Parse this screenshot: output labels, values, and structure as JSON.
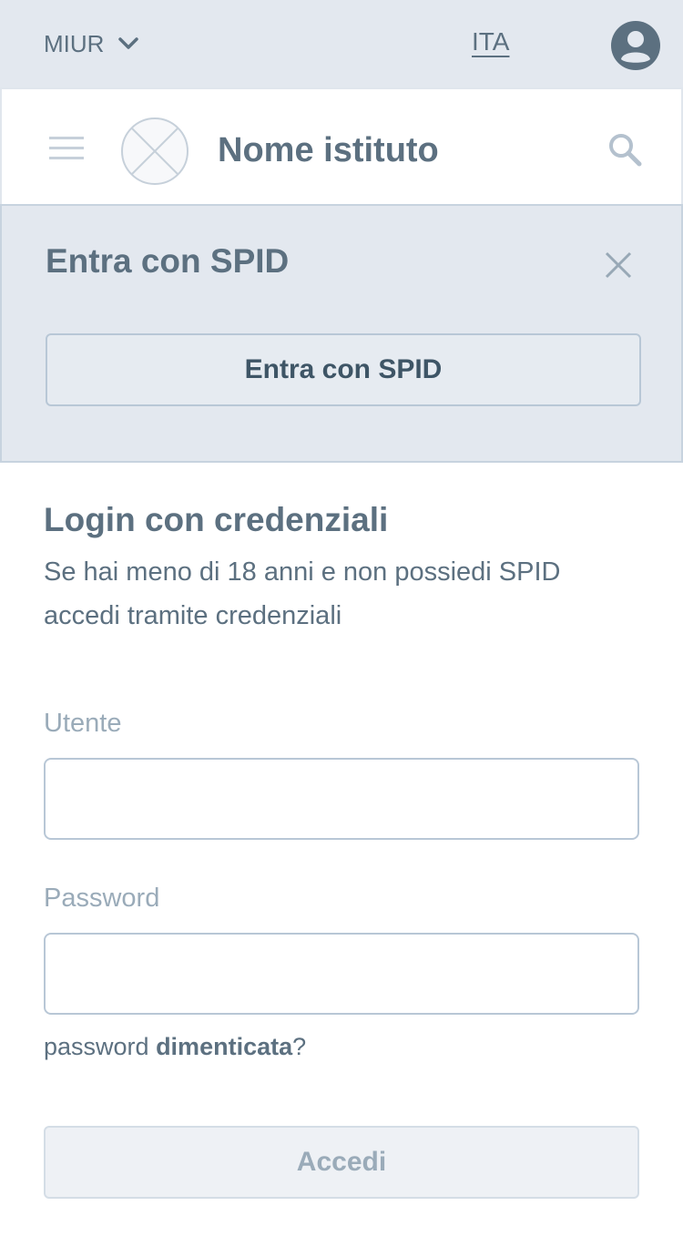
{
  "topbar": {
    "org_label": "MIUR",
    "org_icon": "chevron-down-icon",
    "language": "ITA",
    "user_icon": "user-avatar-icon"
  },
  "header": {
    "menu_icon": "hamburger-icon",
    "logo_icon": "placeholder-logo-icon",
    "institute_name": "Nome istituto",
    "search_icon": "search-icon"
  },
  "spid_panel": {
    "title": "Entra con SPID",
    "close_icon": "close-icon",
    "button_label": "Entra con SPID"
  },
  "login": {
    "title": "Login con credenziali",
    "description": "Se hai meno di 18 anni e non possiedi SPID accedi tramite credenziali",
    "user_label": "Utente",
    "user_value": "",
    "password_label": "Password",
    "password_value": "",
    "forgot_prefix": "password ",
    "forgot_link": "dimenticata",
    "forgot_suffix": "?",
    "submit_label": "Accedi"
  },
  "colors": {
    "topbar_bg": "#e3e8ef",
    "panel_bg": "#e3e8ef",
    "text_primary": "#5c7080",
    "text_muted": "#9aabb9",
    "border": "#b8c7d6"
  }
}
